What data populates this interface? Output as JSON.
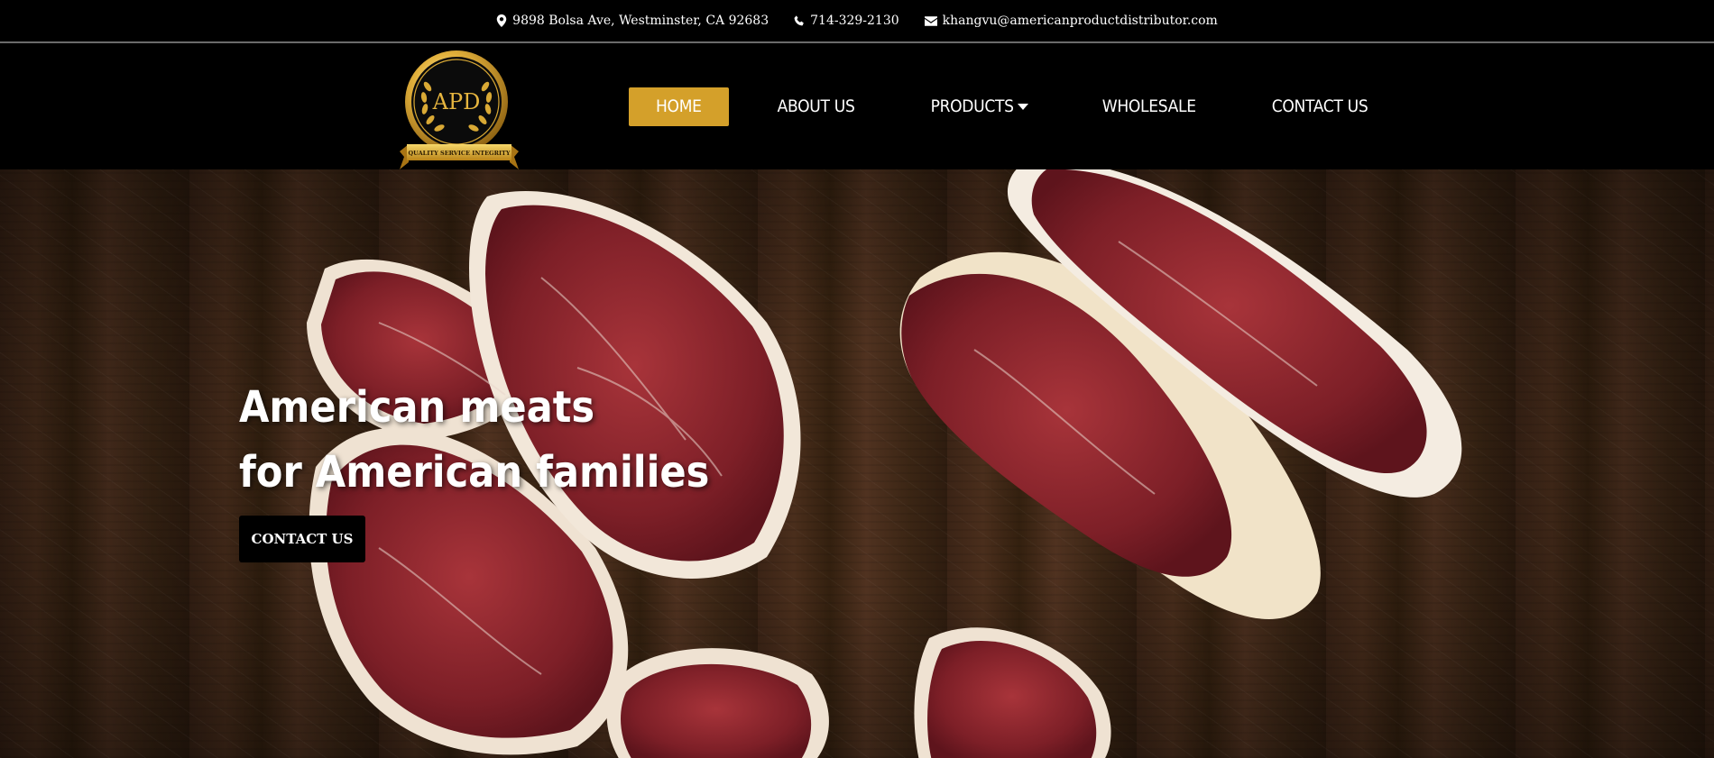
{
  "topbar": {
    "address": "9898 Bolsa Ave, Westminster, CA 92683",
    "phone": "714-329-2130",
    "email": "khangvu@americanproductdistributor.com",
    "icons": {
      "address": "map-marker-icon",
      "phone": "phone-icon",
      "email": "envelope-icon"
    }
  },
  "logo": {
    "text": "APD",
    "ribbon": "QUALITY SERVICE INTEGRITY"
  },
  "nav": {
    "items": [
      {
        "label": "HOME",
        "active": true
      },
      {
        "label": "ABOUT US",
        "active": false
      },
      {
        "label": "PRODUCTS",
        "active": false,
        "has_dropdown": true
      },
      {
        "label": "WHOLESALE",
        "active": false
      },
      {
        "label": "CONTACT US",
        "active": false
      }
    ]
  },
  "hero": {
    "title_line1": "American meats",
    "title_line2": "for American families",
    "cta_label": "CONTACT US"
  },
  "colors": {
    "accent": "#d4a02a",
    "background": "#000000",
    "wood": "#3a2515",
    "meat": "#8e2a2e",
    "fat": "#f1e6d8"
  }
}
